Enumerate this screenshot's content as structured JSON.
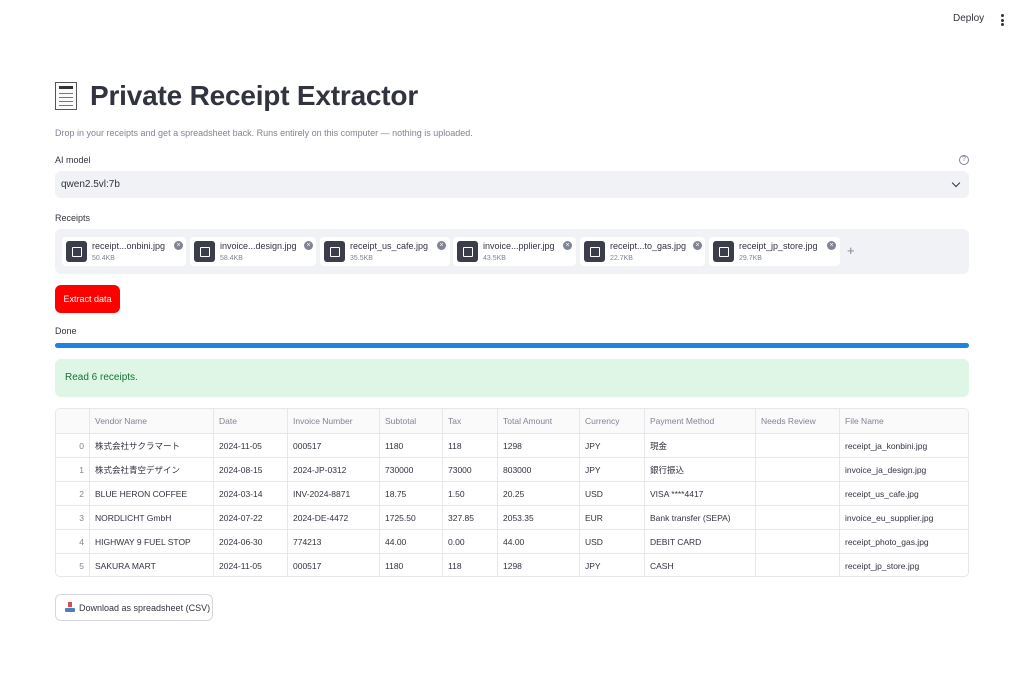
{
  "header": {
    "deploy_label": "Deploy",
    "menu_icon": "kebab-menu-icon"
  },
  "page": {
    "title": "Private Receipt Extractor",
    "title_icon": "receipt-icon",
    "caption": "Drop in your receipts and get a spreadsheet back. Runs entirely on this computer — nothing is uploaded."
  },
  "model": {
    "label": "AI model",
    "selected": "qwen2.5vl:7b",
    "help_icon": "question-circle-icon"
  },
  "uploader": {
    "label": "Receipts",
    "files": [
      {
        "name": "receipt...onbini.jpg",
        "size": "50.4KB"
      },
      {
        "name": "invoice...design.jpg",
        "size": "58.4KB"
      },
      {
        "name": "receipt_us_cafe.jpg",
        "size": "35.5KB"
      },
      {
        "name": "invoice...pplier.jpg",
        "size": "43.5KB"
      },
      {
        "name": "receipt...to_gas.jpg",
        "size": "22.7KB"
      },
      {
        "name": "receipt_jp_store.jpg",
        "size": "29.7KB"
      }
    ],
    "remove_symbol": "×",
    "add_symbol": "+"
  },
  "extract_button": {
    "label": "Extract data"
  },
  "progress": {
    "status": "Done",
    "value": 1.0
  },
  "success": {
    "message": "Read 6 receipts."
  },
  "table": {
    "columns": [
      "",
      "Vendor Name",
      "Date",
      "Invoice Number",
      "Subtotal",
      "Tax",
      "Total Amount",
      "Currency",
      "Payment Method",
      "Needs Review",
      "File Name"
    ],
    "rows": [
      [
        "0",
        "株式会社サクラマート",
        "2024-11-05",
        "000517",
        "1180",
        "118",
        "1298",
        "JPY",
        "現金",
        "",
        "receipt_ja_konbini.jpg"
      ],
      [
        "1",
        "株式会社青空デザイン",
        "2024-08-15",
        "2024-JP-0312",
        "730000",
        "73000",
        "803000",
        "JPY",
        "銀行振込",
        "",
        "invoice_ja_design.jpg"
      ],
      [
        "2",
        "BLUE HERON COFFEE",
        "2024-03-14",
        "INV-2024-8871",
        "18.75",
        "1.50",
        "20.25",
        "USD",
        "VISA ****4417",
        "",
        "receipt_us_cafe.jpg"
      ],
      [
        "3",
        "NORDLICHT GmbH",
        "2024-07-22",
        "2024-DE-4472",
        "1725.50",
        "327.85",
        "2053.35",
        "EUR",
        "Bank transfer (SEPA)",
        "",
        "invoice_eu_supplier.jpg"
      ],
      [
        "4",
        "HIGHWAY 9 FUEL STOP",
        "2024-06-30",
        "774213",
        "44.00",
        "0.00",
        "44.00",
        "USD",
        "DEBIT CARD",
        "",
        "receipt_photo_gas.jpg"
      ],
      [
        "5",
        "SAKURA MART",
        "2024-11-05",
        "000517",
        "1180",
        "118",
        "1298",
        "JPY",
        "CASH",
        "",
        "receipt_jp_store.jpg"
      ]
    ]
  },
  "download": {
    "label": "Download as spreadsheet (CSV)",
    "icon": "download-tray-icon"
  },
  "colors": {
    "primary": "#ff0000",
    "progress": "#1c83e1",
    "success_bg": "#dff5e6",
    "success_text": "#177233"
  }
}
